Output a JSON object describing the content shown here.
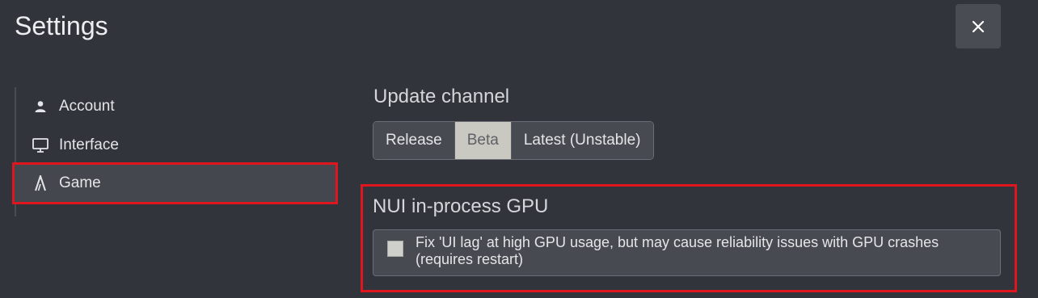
{
  "window": {
    "title": "Settings",
    "close_icon": "close-icon"
  },
  "sidebar": {
    "items": [
      {
        "label": "Account",
        "icon": "user-icon",
        "selected": false
      },
      {
        "label": "Interface",
        "icon": "monitor-icon",
        "selected": false
      },
      {
        "label": "Game",
        "icon": "game-logo-icon",
        "selected": true
      }
    ]
  },
  "update_channel": {
    "heading": "Update channel",
    "options": [
      "Release",
      "Beta",
      "Latest (Unstable)"
    ],
    "selected": "Beta"
  },
  "nui_gpu": {
    "heading": "NUI in-process GPU",
    "checkbox_label": "Fix 'UI lag' at high GPU usage, but may cause reliability issues with GPU crashes (requires restart)",
    "checked": false
  },
  "colors": {
    "highlight": "#e0161e",
    "background": "#32343b",
    "active_segment": "#c9c9c2"
  }
}
